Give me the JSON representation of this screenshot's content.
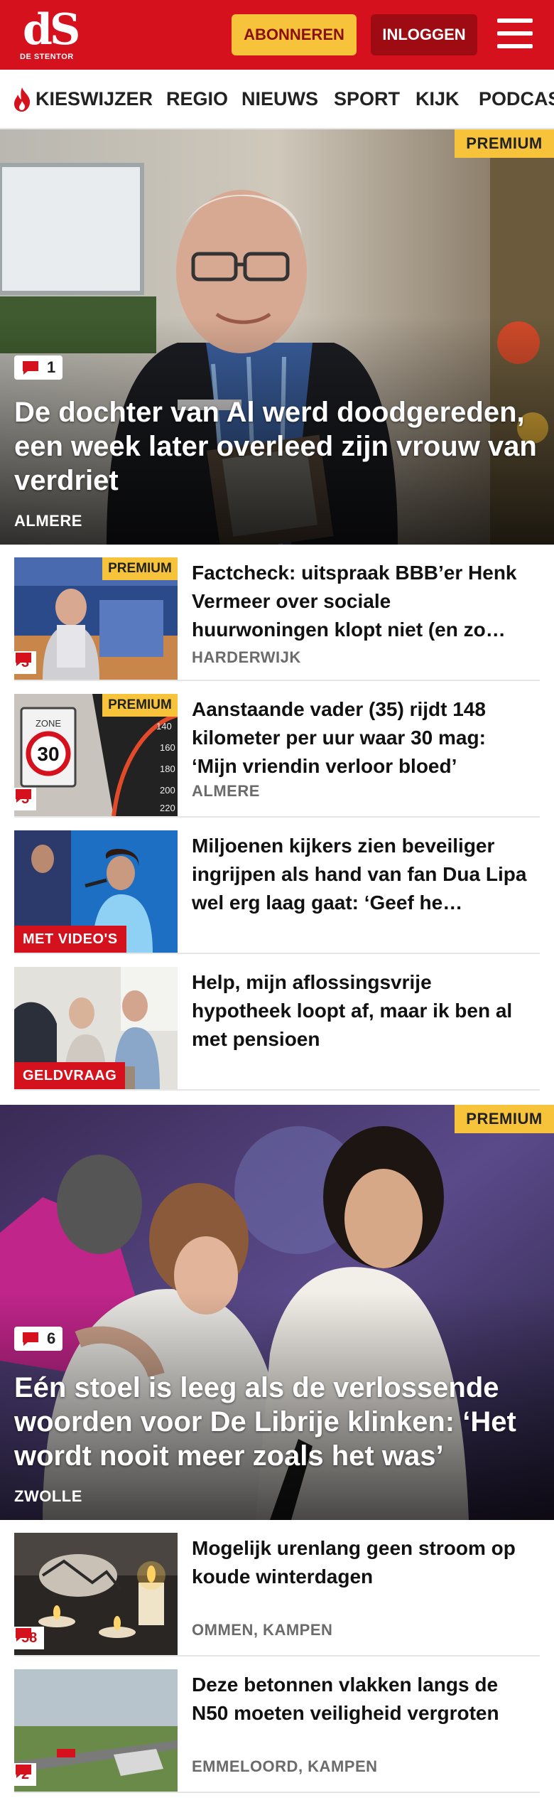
{
  "header": {
    "logo_mark": "dS",
    "logo_sub": "DE STENTOR",
    "subscribe_label": "ABONNEREN",
    "login_label": "INLOGGEN",
    "brand_color": "#d5111d"
  },
  "nav": {
    "items": [
      "KIESWIJZER",
      "REGIO",
      "NIEUWS",
      "SPORT",
      "KIJK",
      "PODCAST"
    ]
  },
  "hero1": {
    "badge": "PREMIUM",
    "comments": "1",
    "title": "De dochter van Al werd doodgereden, een week later overleed zijn vrouw van verdriet",
    "location": "ALMERE"
  },
  "articles": [
    {
      "premium": "PREMIUM",
      "comments": "3",
      "title": "Factcheck: uitspraak BBB’er Henk Vermeer over sociale huurwoningen klopt niet (en zo…",
      "location": "HARDERWIJK"
    },
    {
      "premium": "PREMIUM",
      "comments": "5",
      "title": "Aanstaande vader (35) rijdt 148 kilometer per uur waar 30 mag: ‘Mijn vriendin verloor bloed’",
      "location": "ALMERE"
    },
    {
      "tag": "MET VIDEO'S",
      "title": "Miljoenen kijkers zien beveiliger ingrijpen als hand van fan Dua Lipa wel erg laag gaat: ‘Geef he…",
      "location": ""
    },
    {
      "tag": "GELDVRAAG",
      "title": "Help, mijn aflossingsvrije hypotheek loopt af, maar ik ben al met pensioen",
      "location": ""
    }
  ],
  "hero2": {
    "badge": "PREMIUM",
    "comments": "6",
    "title": "Eén stoel is leeg als de verlossende woorden voor De Librije klinken: ‘Het wordt nooit meer zoals het was’",
    "location": "ZWOLLE"
  },
  "articles2": [
    {
      "comments": "58",
      "title": "Mogelijk urenlang geen stroom op koude winterdagen",
      "location": "OMMEN, KAMPEN"
    },
    {
      "comments": "2",
      "title": "Deze betonnen vlakken langs de N50 moeten veiligheid vergroten",
      "location": "EMMELOORD, KAMPEN"
    }
  ]
}
